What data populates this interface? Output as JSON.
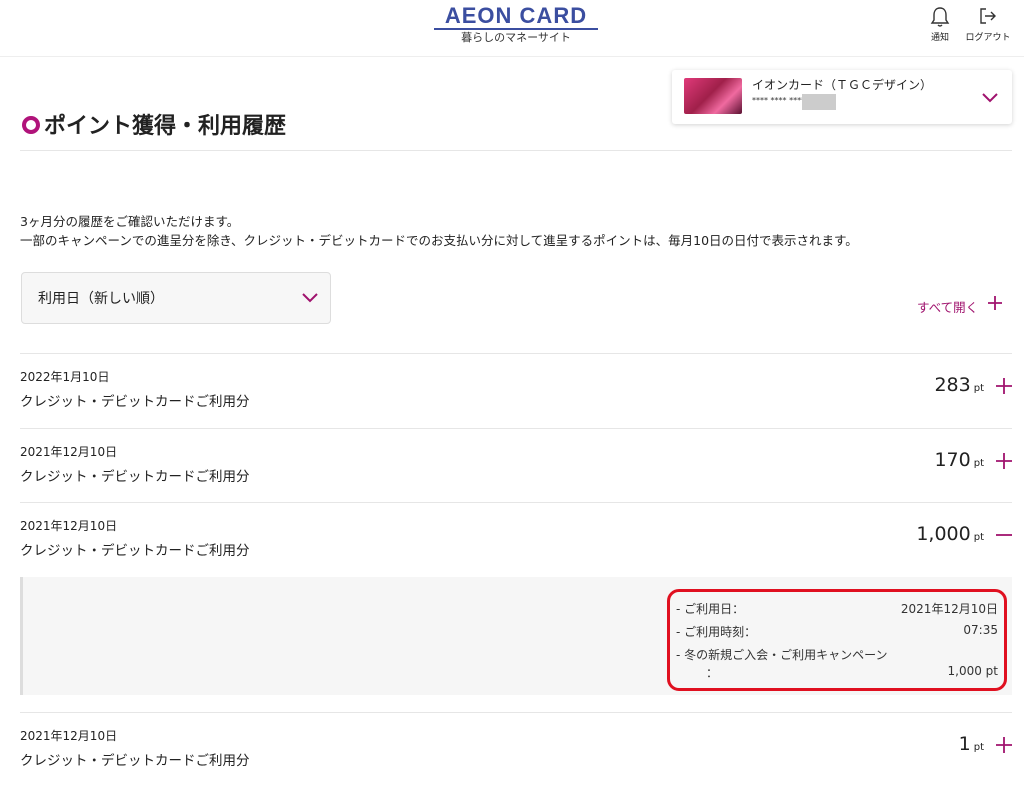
{
  "header": {
    "logo_main": "AEON CARD",
    "logo_sub": "暮らしのマネーサイト",
    "notify_label": "通知",
    "logout_label": "ログアウト"
  },
  "card": {
    "name": "イオンカード（ＴＧＣデザイン）",
    "number": "**** **** ****"
  },
  "page": {
    "title": "ポイント獲得・利用履歴",
    "desc_line1": "3ヶ月分の履歴をご確認いただけます。",
    "desc_line2": "一部のキャンペーンでの進呈分を除き、クレジット・デビットカードでのお支払い分に対して進呈するポイントは、毎月10日の日付で表示されます。",
    "sort_value": "利用日（新しい順）",
    "expand_all": "すべて開く"
  },
  "rows": [
    {
      "date": "2022年1月10日",
      "desc": "クレジット・デビットカードご利用分",
      "points": "283",
      "unit": "pt",
      "toggle": "+"
    },
    {
      "date": "2021年12月10日",
      "desc": "クレジット・デビットカードご利用分",
      "points": "170",
      "unit": "pt",
      "toggle": "+"
    },
    {
      "date": "2021年12月10日",
      "desc": "クレジット・デビットカードご利用分",
      "points": "1,000",
      "unit": "pt",
      "toggle": "−"
    },
    {
      "date": "2021年12月10日",
      "desc": "クレジット・デビットカードご利用分",
      "points": "1",
      "unit": "pt",
      "toggle": "+"
    }
  ],
  "detail": {
    "use_date_label": "- ご利用日：",
    "use_date_value": "2021年12月10日",
    "use_time_label": "- ご利用時刻：",
    "use_time_value": "07:35",
    "campaign_label": "- 冬の新規ご入会・ご利用キャンペーン",
    "campaign_colon": "：",
    "campaign_value": "1,000 pt"
  },
  "colors": {
    "accent": "#a0136e",
    "brand": "#3b4ea0",
    "highlight": "#e01020"
  }
}
